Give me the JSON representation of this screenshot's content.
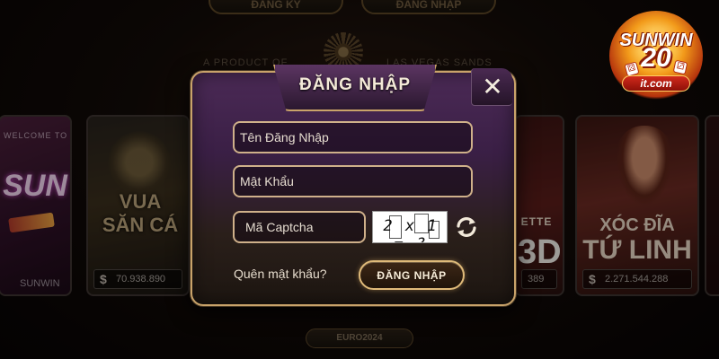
{
  "background": {
    "top_tabs": [
      "ĐĂNG KÝ",
      "ĐĂNG NHẬP"
    ],
    "caption_left": "A PRODUCT OF",
    "caption_right": "LAS VEGAS SANDS",
    "cards": [
      {
        "welcome": "WELCOME TO",
        "title": "SUN",
        "subtitle": "SUNWIN"
      },
      {
        "title_line1": "VUA",
        "title_line2": "SĂN CÁ",
        "jackpot": "70.938.890"
      },
      {
        "title": "ETTE",
        "big": "3D",
        "jackpot": "389"
      },
      {
        "title_line1": "XÓC ĐĨA",
        "title_line2": "TỨ LINH",
        "jackpot": "2.271.544.288"
      }
    ],
    "currency_symbol": "$",
    "bottom_badge": "EURO2024"
  },
  "logo": {
    "brand": "SUNWIN",
    "number": "20",
    "domain": "it.com"
  },
  "dialog": {
    "title": "ĐĂNG NHẬP",
    "close_label": "✕",
    "username": {
      "value": "",
      "placeholder": "Tên Đăng Nhập"
    },
    "password": {
      "value": "",
      "placeholder": "Mật Khẩu"
    },
    "captcha": {
      "value": "",
      "placeholder": "Mã Captcha",
      "image_text": "2 x 1 = ?"
    },
    "forgot_label": "Quên mật khẩu?",
    "submit_label": "ĐĂNG NHẬP"
  },
  "icons": {
    "close": "close-icon",
    "refresh": "refresh-icon"
  },
  "colors": {
    "gold_border": "#c9a36a",
    "dialog_purple": "#4b2a56",
    "button_gold": "#e0bb7a"
  }
}
